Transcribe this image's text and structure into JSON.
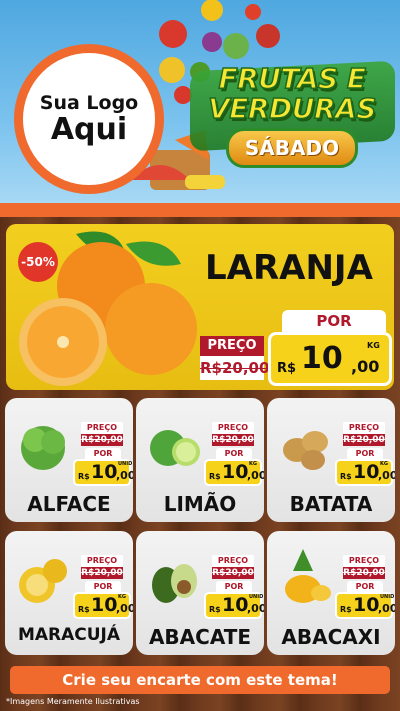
{
  "header": {
    "logo_line1": "Sua Logo",
    "logo_line2": "Aqui",
    "title_line1": "FRUTAS E",
    "title_line2": "VERDURAS",
    "day": "SÁBADO"
  },
  "hero": {
    "discount": "-50%",
    "name": "LARANJA",
    "preco_label": "PREÇO",
    "old_price": "R$20,00",
    "por_label": "POR",
    "currency": "R$",
    "price_int": "10",
    "price_dec": ",00",
    "unit": "KG"
  },
  "products": [
    {
      "name": "ALFACE",
      "preco_label": "PREÇO",
      "old_price": "R$20,00",
      "por_label": "POR",
      "currency": "R$",
      "price_int": "10",
      "price_dec": ",00",
      "unit": "UNID",
      "icon": "lettuce-icon"
    },
    {
      "name": "LIMÃO",
      "preco_label": "PREÇO",
      "old_price": "R$20,00",
      "por_label": "POR",
      "currency": "R$",
      "price_int": "10",
      "price_dec": ",00",
      "unit": "KG",
      "icon": "lime-icon"
    },
    {
      "name": "BATATA",
      "preco_label": "PREÇO",
      "old_price": "R$20,00",
      "por_label": "POR",
      "currency": "R$",
      "price_int": "10",
      "price_dec": ",00",
      "unit": "KG",
      "icon": "potato-icon"
    },
    {
      "name": "MARACUJÁ",
      "preco_label": "PREÇO",
      "old_price": "R$20,00",
      "por_label": "POR",
      "currency": "R$",
      "price_int": "10",
      "price_dec": ",00",
      "unit": "KG",
      "icon": "passion-fruit-icon"
    },
    {
      "name": "ABACATE",
      "preco_label": "PREÇO",
      "old_price": "R$20,00",
      "por_label": "POR",
      "currency": "R$",
      "price_int": "10",
      "price_dec": ",00",
      "unit": "UNID",
      "icon": "avocado-icon"
    },
    {
      "name": "ABACAXI",
      "preco_label": "PREÇO",
      "old_price": "R$20,00",
      "por_label": "POR",
      "currency": "R$",
      "price_int": "10",
      "price_dec": ",00",
      "unit": "UNID",
      "icon": "pineapple-icon"
    }
  ],
  "footer": {
    "cta": "Crie seu encarte com este tema!",
    "disclaimer": "*Imagens Meramente Ilustrativas"
  },
  "colors": {
    "accent_orange": "#ef6a2c",
    "price_red": "#b0182b",
    "price_yellow": "#f6d21a",
    "title_green": "#2e8b2a"
  }
}
